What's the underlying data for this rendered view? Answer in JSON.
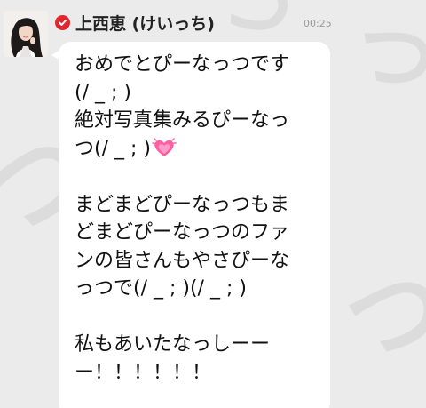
{
  "sender": {
    "name": "上西恵 (けいっち)",
    "verified": true
  },
  "message": {
    "timestamp": "00:25",
    "lines": [
      "おめでとぴーなっつです",
      "(/ _ ; )",
      "絶対写真集みるぴーなっ",
      "つ(/ _ ; )",
      "",
      "まどまどぴーなっつもま",
      "どまどぴーなっつのファ",
      "ンの皆さんもやさぴーな",
      "っつで(/ _ ; )(/ _ ; )",
      "",
      "私もあいたなっしーー",
      "ー！！！！！！"
    ],
    "emoji_after_line_4": "sparkling-heart-icon"
  },
  "colors": {
    "background": "#ebebeb",
    "bubble": "#ffffff",
    "verified_badge": "#e0272f",
    "heart": "#ff5fa2"
  }
}
